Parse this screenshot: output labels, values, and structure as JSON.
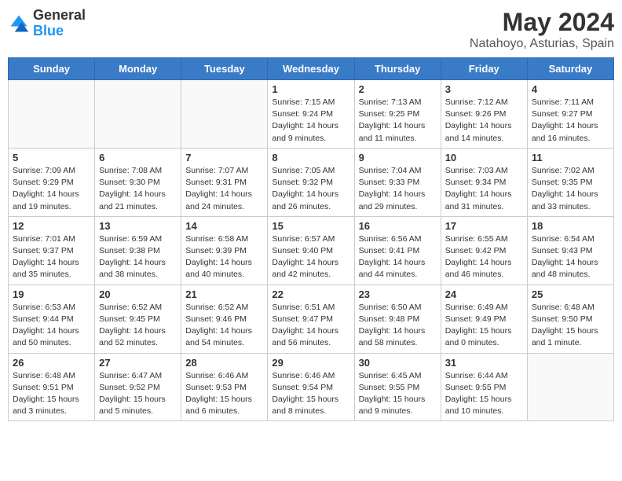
{
  "header": {
    "logo_general": "General",
    "logo_blue": "Blue",
    "month_year": "May 2024",
    "location": "Natahoyo, Asturias, Spain"
  },
  "days_of_week": [
    "Sunday",
    "Monday",
    "Tuesday",
    "Wednesday",
    "Thursday",
    "Friday",
    "Saturday"
  ],
  "weeks": [
    [
      {
        "day": "",
        "info": "",
        "empty": true
      },
      {
        "day": "",
        "info": "",
        "empty": true
      },
      {
        "day": "",
        "info": "",
        "empty": true
      },
      {
        "day": "1",
        "info": "Sunrise: 7:15 AM\nSunset: 9:24 PM\nDaylight: 14 hours\nand 9 minutes."
      },
      {
        "day": "2",
        "info": "Sunrise: 7:13 AM\nSunset: 9:25 PM\nDaylight: 14 hours\nand 11 minutes."
      },
      {
        "day": "3",
        "info": "Sunrise: 7:12 AM\nSunset: 9:26 PM\nDaylight: 14 hours\nand 14 minutes."
      },
      {
        "day": "4",
        "info": "Sunrise: 7:11 AM\nSunset: 9:27 PM\nDaylight: 14 hours\nand 16 minutes."
      }
    ],
    [
      {
        "day": "5",
        "info": "Sunrise: 7:09 AM\nSunset: 9:29 PM\nDaylight: 14 hours\nand 19 minutes."
      },
      {
        "day": "6",
        "info": "Sunrise: 7:08 AM\nSunset: 9:30 PM\nDaylight: 14 hours\nand 21 minutes."
      },
      {
        "day": "7",
        "info": "Sunrise: 7:07 AM\nSunset: 9:31 PM\nDaylight: 14 hours\nand 24 minutes."
      },
      {
        "day": "8",
        "info": "Sunrise: 7:05 AM\nSunset: 9:32 PM\nDaylight: 14 hours\nand 26 minutes."
      },
      {
        "day": "9",
        "info": "Sunrise: 7:04 AM\nSunset: 9:33 PM\nDaylight: 14 hours\nand 29 minutes."
      },
      {
        "day": "10",
        "info": "Sunrise: 7:03 AM\nSunset: 9:34 PM\nDaylight: 14 hours\nand 31 minutes."
      },
      {
        "day": "11",
        "info": "Sunrise: 7:02 AM\nSunset: 9:35 PM\nDaylight: 14 hours\nand 33 minutes."
      }
    ],
    [
      {
        "day": "12",
        "info": "Sunrise: 7:01 AM\nSunset: 9:37 PM\nDaylight: 14 hours\nand 35 minutes."
      },
      {
        "day": "13",
        "info": "Sunrise: 6:59 AM\nSunset: 9:38 PM\nDaylight: 14 hours\nand 38 minutes."
      },
      {
        "day": "14",
        "info": "Sunrise: 6:58 AM\nSunset: 9:39 PM\nDaylight: 14 hours\nand 40 minutes."
      },
      {
        "day": "15",
        "info": "Sunrise: 6:57 AM\nSunset: 9:40 PM\nDaylight: 14 hours\nand 42 minutes."
      },
      {
        "day": "16",
        "info": "Sunrise: 6:56 AM\nSunset: 9:41 PM\nDaylight: 14 hours\nand 44 minutes."
      },
      {
        "day": "17",
        "info": "Sunrise: 6:55 AM\nSunset: 9:42 PM\nDaylight: 14 hours\nand 46 minutes."
      },
      {
        "day": "18",
        "info": "Sunrise: 6:54 AM\nSunset: 9:43 PM\nDaylight: 14 hours\nand 48 minutes."
      }
    ],
    [
      {
        "day": "19",
        "info": "Sunrise: 6:53 AM\nSunset: 9:44 PM\nDaylight: 14 hours\nand 50 minutes."
      },
      {
        "day": "20",
        "info": "Sunrise: 6:52 AM\nSunset: 9:45 PM\nDaylight: 14 hours\nand 52 minutes."
      },
      {
        "day": "21",
        "info": "Sunrise: 6:52 AM\nSunset: 9:46 PM\nDaylight: 14 hours\nand 54 minutes."
      },
      {
        "day": "22",
        "info": "Sunrise: 6:51 AM\nSunset: 9:47 PM\nDaylight: 14 hours\nand 56 minutes."
      },
      {
        "day": "23",
        "info": "Sunrise: 6:50 AM\nSunset: 9:48 PM\nDaylight: 14 hours\nand 58 minutes."
      },
      {
        "day": "24",
        "info": "Sunrise: 6:49 AM\nSunset: 9:49 PM\nDaylight: 15 hours\nand 0 minutes."
      },
      {
        "day": "25",
        "info": "Sunrise: 6:48 AM\nSunset: 9:50 PM\nDaylight: 15 hours\nand 1 minute."
      }
    ],
    [
      {
        "day": "26",
        "info": "Sunrise: 6:48 AM\nSunset: 9:51 PM\nDaylight: 15 hours\nand 3 minutes."
      },
      {
        "day": "27",
        "info": "Sunrise: 6:47 AM\nSunset: 9:52 PM\nDaylight: 15 hours\nand 5 minutes."
      },
      {
        "day": "28",
        "info": "Sunrise: 6:46 AM\nSunset: 9:53 PM\nDaylight: 15 hours\nand 6 minutes."
      },
      {
        "day": "29",
        "info": "Sunrise: 6:46 AM\nSunset: 9:54 PM\nDaylight: 15 hours\nand 8 minutes."
      },
      {
        "day": "30",
        "info": "Sunrise: 6:45 AM\nSunset: 9:55 PM\nDaylight: 15 hours\nand 9 minutes."
      },
      {
        "day": "31",
        "info": "Sunrise: 6:44 AM\nSunset: 9:55 PM\nDaylight: 15 hours\nand 10 minutes."
      },
      {
        "day": "",
        "info": "",
        "empty": true
      }
    ]
  ]
}
